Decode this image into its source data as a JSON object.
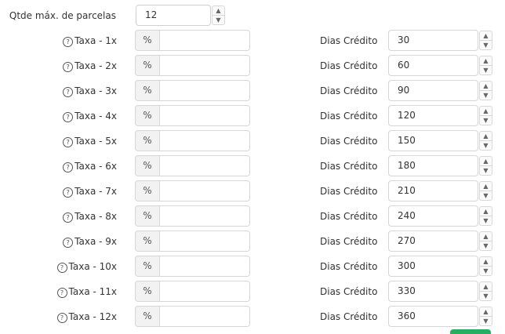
{
  "qtde": {
    "label": "Qtde máx. de parcelas",
    "value": "12"
  },
  "taxa_unit": "%",
  "help_glyph": "?",
  "spinner": {
    "up": "▲",
    "down": "▼"
  },
  "rows": [
    {
      "taxa_label": "Taxa - 1x",
      "taxa_value": "",
      "dias_label": "Dias Crédito",
      "dias_value": "30"
    },
    {
      "taxa_label": "Taxa - 2x",
      "taxa_value": "",
      "dias_label": "Dias Crédito",
      "dias_value": "60"
    },
    {
      "taxa_label": "Taxa - 3x",
      "taxa_value": "",
      "dias_label": "Dias Crédito",
      "dias_value": "90"
    },
    {
      "taxa_label": "Taxa - 4x",
      "taxa_value": "",
      "dias_label": "Dias Crédito",
      "dias_value": "120"
    },
    {
      "taxa_label": "Taxa - 5x",
      "taxa_value": "",
      "dias_label": "Dias Crédito",
      "dias_value": "150"
    },
    {
      "taxa_label": "Taxa - 6x",
      "taxa_value": "",
      "dias_label": "Dias Crédito",
      "dias_value": "180"
    },
    {
      "taxa_label": "Taxa - 7x",
      "taxa_value": "",
      "dias_label": "Dias Crédito",
      "dias_value": "210"
    },
    {
      "taxa_label": "Taxa - 8x",
      "taxa_value": "",
      "dias_label": "Dias Crédito",
      "dias_value": "240"
    },
    {
      "taxa_label": "Taxa - 9x",
      "taxa_value": "",
      "dias_label": "Dias Crédito",
      "dias_value": "270"
    },
    {
      "taxa_label": "Taxa - 10x",
      "taxa_value": "",
      "dias_label": "Dias Crédito",
      "dias_value": "300"
    },
    {
      "taxa_label": "Taxa - 11x",
      "taxa_value": "",
      "dias_label": "Dias Crédito",
      "dias_value": "330"
    },
    {
      "taxa_label": "Taxa - 12x",
      "taxa_value": "",
      "dias_label": "Dias Crédito",
      "dias_value": "360"
    }
  ],
  "colors": {
    "save_button": "#27ae60",
    "addon_bg": "#f2f2f2",
    "border": "#d6d6d6"
  }
}
